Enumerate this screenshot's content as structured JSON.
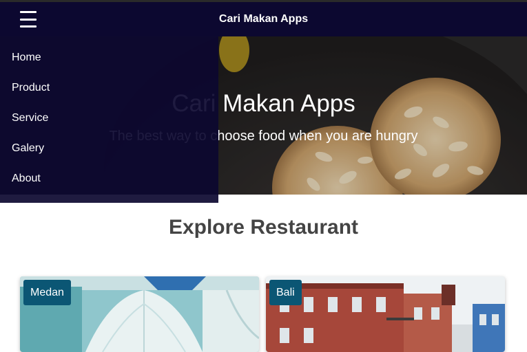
{
  "app_bar": {
    "title": "Cari Makan Apps",
    "menu_icon": "hamburger-icon",
    "background": "#0c0830"
  },
  "nav": {
    "items": [
      {
        "label": "Home"
      },
      {
        "label": "Product"
      },
      {
        "label": "Service"
      },
      {
        "label": "Galery"
      },
      {
        "label": "About"
      }
    ]
  },
  "hero": {
    "title": "Cari Makan Apps",
    "subtitle": "The best way to choose food when you are hungry"
  },
  "explore": {
    "heading": "Explore Restaurant",
    "cards": [
      {
        "city": "Medan"
      },
      {
        "city": "Bali"
      }
    ],
    "badge_color": "#0b5674"
  }
}
